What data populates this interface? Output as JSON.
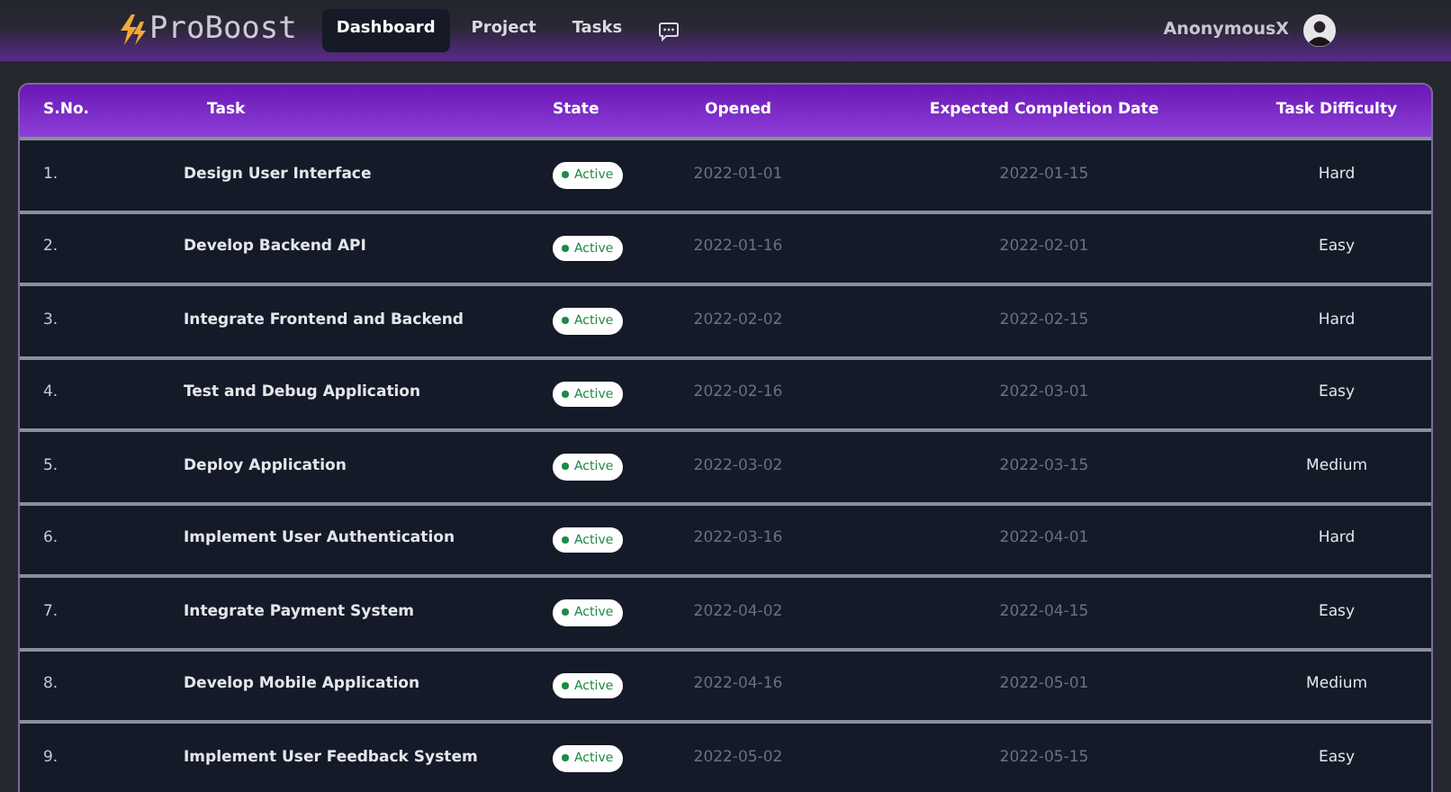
{
  "navbar": {
    "brand": "ProBoost",
    "links": [
      {
        "label": "Dashboard",
        "selected": true
      },
      {
        "label": "Project",
        "selected": false
      },
      {
        "label": "Tasks",
        "selected": false
      }
    ],
    "user": "AnonymousX"
  },
  "table": {
    "columns": [
      "S.No.",
      "Task",
      "State",
      "Opened",
      "Expected Completion Date",
      "Task Difficulty"
    ],
    "rows": [
      {
        "number": "1.",
        "task": "Design User Interface",
        "state": "Active",
        "opened": "2022-01-01",
        "expected": "2022-01-15",
        "difficulty": "Hard"
      },
      {
        "number": "2.",
        "task": "Develop Backend API",
        "state": "Active",
        "opened": "2022-01-16",
        "expected": "2022-02-01",
        "difficulty": "Easy"
      },
      {
        "number": "3.",
        "task": "Integrate Frontend and Backend",
        "state": "Active",
        "opened": "2022-02-02",
        "expected": "2022-02-15",
        "difficulty": "Hard"
      },
      {
        "number": "4.",
        "task": "Test and Debug Application",
        "state": "Active",
        "opened": "2022-02-16",
        "expected": "2022-03-01",
        "difficulty": "Easy"
      },
      {
        "number": "5.",
        "task": "Deploy Application",
        "state": "Active",
        "opened": "2022-03-02",
        "expected": "2022-03-15",
        "difficulty": "Medium"
      },
      {
        "number": "6.",
        "task": "Implement User Authentication",
        "state": "Active",
        "opened": "2022-03-16",
        "expected": "2022-04-01",
        "difficulty": "Hard"
      },
      {
        "number": "7.",
        "task": "Integrate Payment System",
        "state": "Active",
        "opened": "2022-04-02",
        "expected": "2022-04-15",
        "difficulty": "Easy"
      },
      {
        "number": "8.",
        "task": "Develop Mobile Application",
        "state": "Active",
        "opened": "2022-04-16",
        "expected": "2022-05-01",
        "difficulty": "Medium"
      },
      {
        "number": "9.",
        "task": "Implement User Feedback System",
        "state": "Active",
        "opened": "2022-05-02",
        "expected": "2022-05-15",
        "difficulty": "Easy"
      }
    ]
  }
}
